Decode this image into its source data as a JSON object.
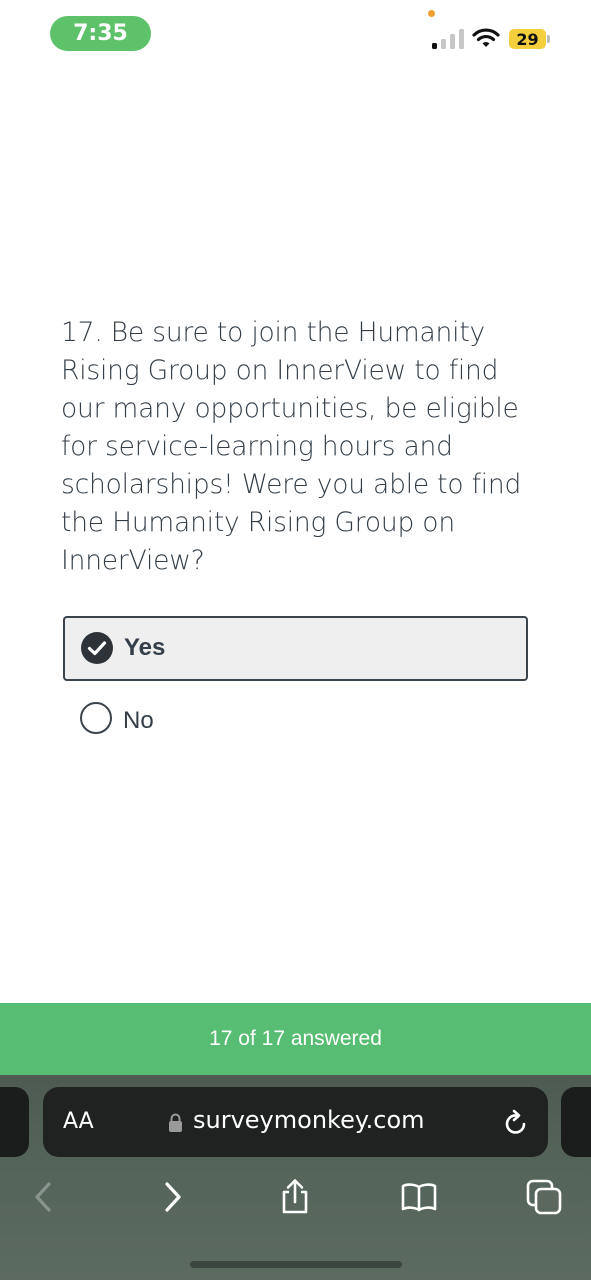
{
  "status_bar": {
    "time": "7:35",
    "battery": "29",
    "icons": [
      "signal-icon",
      "wifi-icon",
      "battery-icon"
    ]
  },
  "question": {
    "text": "17. Be sure to join the Humanity Rising Group on InnerView to find our many opportunities, be eligible for service-learning hours and scholarships!   Were you able to find the Humanity Rising Group on InnerView?"
  },
  "options": [
    {
      "label": "Yes",
      "selected": true
    },
    {
      "label": "No",
      "selected": false
    }
  ],
  "progress": {
    "text": "17 of 17 answered",
    "answered": 17,
    "total": 17
  },
  "browser": {
    "aa_label": "AA",
    "url": "surveymonkey.com",
    "toolbar_icons": [
      "back-icon",
      "forward-icon",
      "share-icon",
      "bookmarks-icon",
      "tabs-icon"
    ]
  },
  "colors": {
    "accent_green": "#57bd73",
    "time_pill": "#5ec26a",
    "battery": "#f5cf3b",
    "text": "#333e48"
  }
}
